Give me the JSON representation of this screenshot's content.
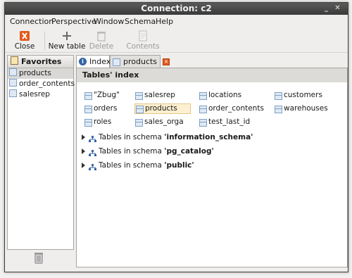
{
  "window": {
    "title": "Connection: c2"
  },
  "menubar": [
    "Connection",
    "Perspective",
    "Window",
    "Schema",
    "Help"
  ],
  "toolbar": {
    "close": "Close",
    "new_table": "New table",
    "delete": "Delete",
    "contents": "Contents"
  },
  "favorites": {
    "header": "Favorites",
    "items": [
      "products",
      "order_contents",
      "salesrep"
    ],
    "selected": "products"
  },
  "tabs": [
    {
      "label": "Index",
      "active": true
    },
    {
      "label": "products",
      "closable": true
    }
  ],
  "index": {
    "header": "Tables' index",
    "tables": [
      "\"Zbug\"",
      "salesrep",
      "locations",
      "customers",
      "orders",
      "products",
      "order_contents",
      "warehouses",
      "roles",
      "sales_orga",
      "test_last_id"
    ],
    "selected": "products",
    "schema_prefix": "Tables in schema",
    "schemas": [
      "'information_schema'",
      "'pg_catalog'",
      "'public'"
    ]
  },
  "colors": {
    "titlebar": "#3a3a3a",
    "close_icon": "#e25a1c",
    "selected_row": "#fdf0d0"
  }
}
